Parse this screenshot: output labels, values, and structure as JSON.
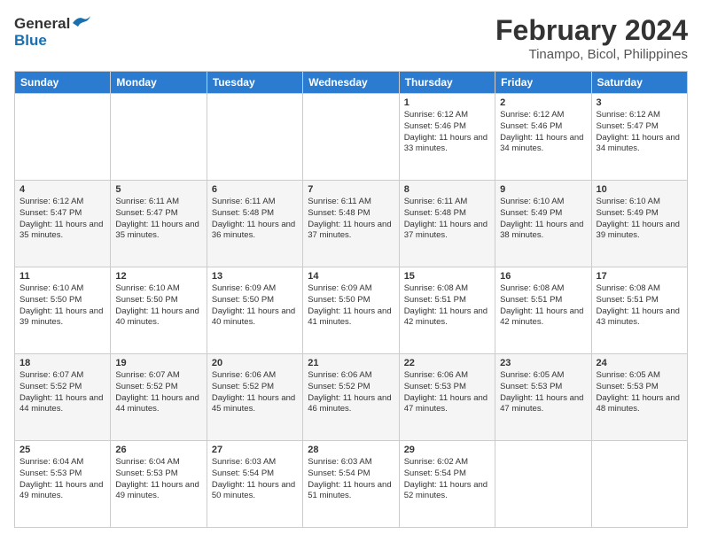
{
  "logo": {
    "line1": "General",
    "line2": "Blue"
  },
  "title": "February 2024",
  "subtitle": "Tinampo, Bicol, Philippines",
  "days_of_week": [
    "Sunday",
    "Monday",
    "Tuesday",
    "Wednesday",
    "Thursday",
    "Friday",
    "Saturday"
  ],
  "weeks": [
    [
      {
        "day": "",
        "info": ""
      },
      {
        "day": "",
        "info": ""
      },
      {
        "day": "",
        "info": ""
      },
      {
        "day": "",
        "info": ""
      },
      {
        "day": "1",
        "info": "Sunrise: 6:12 AM\nSunset: 5:46 PM\nDaylight: 11 hours and 33 minutes."
      },
      {
        "day": "2",
        "info": "Sunrise: 6:12 AM\nSunset: 5:46 PM\nDaylight: 11 hours and 34 minutes."
      },
      {
        "day": "3",
        "info": "Sunrise: 6:12 AM\nSunset: 5:47 PM\nDaylight: 11 hours and 34 minutes."
      }
    ],
    [
      {
        "day": "4",
        "info": "Sunrise: 6:12 AM\nSunset: 5:47 PM\nDaylight: 11 hours and 35 minutes."
      },
      {
        "day": "5",
        "info": "Sunrise: 6:11 AM\nSunset: 5:47 PM\nDaylight: 11 hours and 35 minutes."
      },
      {
        "day": "6",
        "info": "Sunrise: 6:11 AM\nSunset: 5:48 PM\nDaylight: 11 hours and 36 minutes."
      },
      {
        "day": "7",
        "info": "Sunrise: 6:11 AM\nSunset: 5:48 PM\nDaylight: 11 hours and 37 minutes."
      },
      {
        "day": "8",
        "info": "Sunrise: 6:11 AM\nSunset: 5:48 PM\nDaylight: 11 hours and 37 minutes."
      },
      {
        "day": "9",
        "info": "Sunrise: 6:10 AM\nSunset: 5:49 PM\nDaylight: 11 hours and 38 minutes."
      },
      {
        "day": "10",
        "info": "Sunrise: 6:10 AM\nSunset: 5:49 PM\nDaylight: 11 hours and 39 minutes."
      }
    ],
    [
      {
        "day": "11",
        "info": "Sunrise: 6:10 AM\nSunset: 5:50 PM\nDaylight: 11 hours and 39 minutes."
      },
      {
        "day": "12",
        "info": "Sunrise: 6:10 AM\nSunset: 5:50 PM\nDaylight: 11 hours and 40 minutes."
      },
      {
        "day": "13",
        "info": "Sunrise: 6:09 AM\nSunset: 5:50 PM\nDaylight: 11 hours and 40 minutes."
      },
      {
        "day": "14",
        "info": "Sunrise: 6:09 AM\nSunset: 5:50 PM\nDaylight: 11 hours and 41 minutes."
      },
      {
        "day": "15",
        "info": "Sunrise: 6:08 AM\nSunset: 5:51 PM\nDaylight: 11 hours and 42 minutes."
      },
      {
        "day": "16",
        "info": "Sunrise: 6:08 AM\nSunset: 5:51 PM\nDaylight: 11 hours and 42 minutes."
      },
      {
        "day": "17",
        "info": "Sunrise: 6:08 AM\nSunset: 5:51 PM\nDaylight: 11 hours and 43 minutes."
      }
    ],
    [
      {
        "day": "18",
        "info": "Sunrise: 6:07 AM\nSunset: 5:52 PM\nDaylight: 11 hours and 44 minutes."
      },
      {
        "day": "19",
        "info": "Sunrise: 6:07 AM\nSunset: 5:52 PM\nDaylight: 11 hours and 44 minutes."
      },
      {
        "day": "20",
        "info": "Sunrise: 6:06 AM\nSunset: 5:52 PM\nDaylight: 11 hours and 45 minutes."
      },
      {
        "day": "21",
        "info": "Sunrise: 6:06 AM\nSunset: 5:52 PM\nDaylight: 11 hours and 46 minutes."
      },
      {
        "day": "22",
        "info": "Sunrise: 6:06 AM\nSunset: 5:53 PM\nDaylight: 11 hours and 47 minutes."
      },
      {
        "day": "23",
        "info": "Sunrise: 6:05 AM\nSunset: 5:53 PM\nDaylight: 11 hours and 47 minutes."
      },
      {
        "day": "24",
        "info": "Sunrise: 6:05 AM\nSunset: 5:53 PM\nDaylight: 11 hours and 48 minutes."
      }
    ],
    [
      {
        "day": "25",
        "info": "Sunrise: 6:04 AM\nSunset: 5:53 PM\nDaylight: 11 hours and 49 minutes."
      },
      {
        "day": "26",
        "info": "Sunrise: 6:04 AM\nSunset: 5:53 PM\nDaylight: 11 hours and 49 minutes."
      },
      {
        "day": "27",
        "info": "Sunrise: 6:03 AM\nSunset: 5:54 PM\nDaylight: 11 hours and 50 minutes."
      },
      {
        "day": "28",
        "info": "Sunrise: 6:03 AM\nSunset: 5:54 PM\nDaylight: 11 hours and 51 minutes."
      },
      {
        "day": "29",
        "info": "Sunrise: 6:02 AM\nSunset: 5:54 PM\nDaylight: 11 hours and 52 minutes."
      },
      {
        "day": "",
        "info": ""
      },
      {
        "day": "",
        "info": ""
      }
    ]
  ]
}
